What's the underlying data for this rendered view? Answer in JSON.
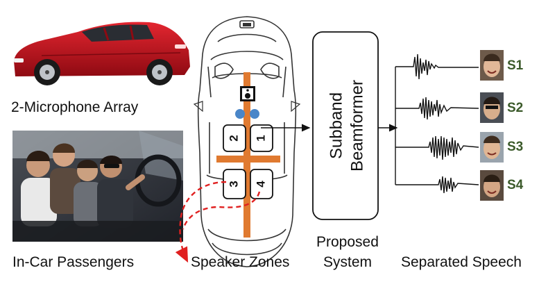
{
  "labels": {
    "mic_array": "2-Microphone Array",
    "passengers": "In-Car Passengers",
    "zones": "Speaker Zones",
    "proposed_line1": "Proposed",
    "proposed_line2": "System",
    "separated": "Separated Speech",
    "beamformer_line1": "Subband",
    "beamformer_line2": "Beamformer"
  },
  "zones": [
    "1",
    "2",
    "3",
    "4"
  ],
  "speakers": [
    "S1",
    "S2",
    "S3",
    "S4"
  ],
  "colors": {
    "car_red": "#c8101e",
    "zone_axis": "#e07a30",
    "mic_blue": "#4a86c8",
    "arrow_red": "#e02020",
    "speaker_green": "#3b5a2a"
  }
}
